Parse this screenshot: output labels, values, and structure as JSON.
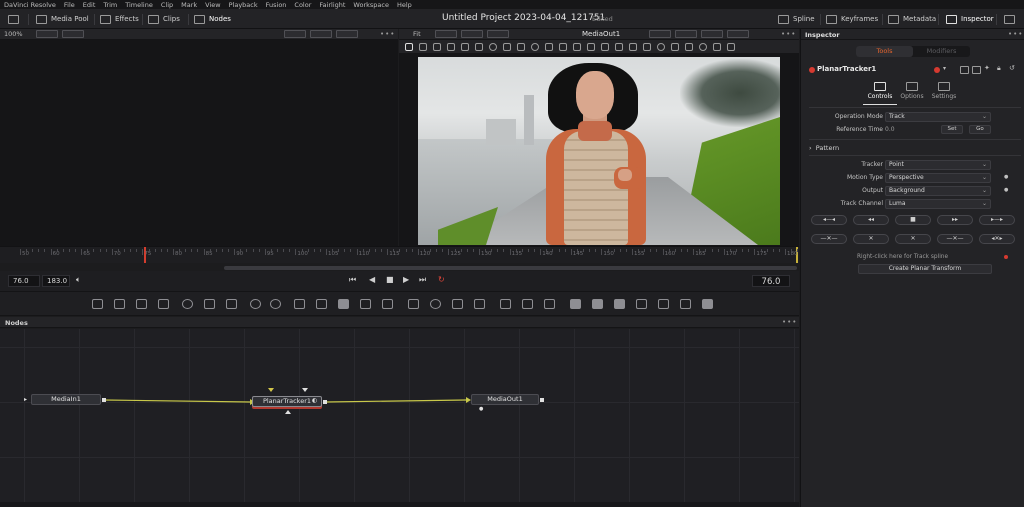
{
  "menubar": [
    "DaVinci Resolve",
    "File",
    "Edit",
    "Trim",
    "Timeline",
    "Clip",
    "Mark",
    "View",
    "Playback",
    "Fusion",
    "Color",
    "Fairlight",
    "Workspace",
    "Help"
  ],
  "toolbar": {
    "media_pool": "Media Pool",
    "effects": "Effects",
    "clips": "Clips",
    "nodes": "Nodes",
    "project_title": "Untitled Project 2023-04-04_121751",
    "project_status": "Edited",
    "spline": "Spline",
    "keyframes": "Keyframes",
    "metadata": "Metadata",
    "inspector": "Inspector"
  },
  "viewer": {
    "left_zoom": "100%",
    "right_fit": "Fit",
    "right_title": "MediaOut1"
  },
  "ruler": {
    "labels": [
      "50",
      "60",
      "65",
      "70",
      "75",
      "80",
      "85",
      "90",
      "95",
      "100",
      "105",
      "110",
      "115",
      "120",
      "125",
      "130",
      "135",
      "140",
      "145",
      "150",
      "155",
      "160",
      "165",
      "170",
      "175",
      "180"
    ]
  },
  "transport": {
    "start": "76.0",
    "end": "183.0",
    "current": "76.0"
  },
  "nodes": {
    "title": "Nodes",
    "items": [
      {
        "label": "MediaIn1"
      },
      {
        "label": "PlanarTracker1"
      },
      {
        "label": "MediaOut1"
      }
    ]
  },
  "inspector": {
    "title": "Inspector",
    "tab_tools": "Tools",
    "tab_modifiers": "Modifiers",
    "tool_name": "PlanarTracker1",
    "subtabs": [
      "Controls",
      "Options",
      "Settings"
    ],
    "operation_mode_label": "Operation Mode",
    "operation_mode": "Track",
    "reference_time_label": "Reference Time",
    "reference_time": "0.0",
    "set_label": "Set",
    "go_label": "Go",
    "pattern_label": "Pattern",
    "tracker_label": "Tracker",
    "tracker": "Point",
    "motion_type_label": "Motion Type",
    "motion_type": "Perspective",
    "output_label": "Output",
    "output": "Background",
    "track_channel_label": "Track Channel",
    "track_channel": "Luma",
    "hint": "Right-click here for Track spline",
    "create_button": "Create Planar Transform"
  },
  "colors": {
    "accent": "#e6652e",
    "playhead": "#d33d2e",
    "wire": "#c8c84a"
  }
}
